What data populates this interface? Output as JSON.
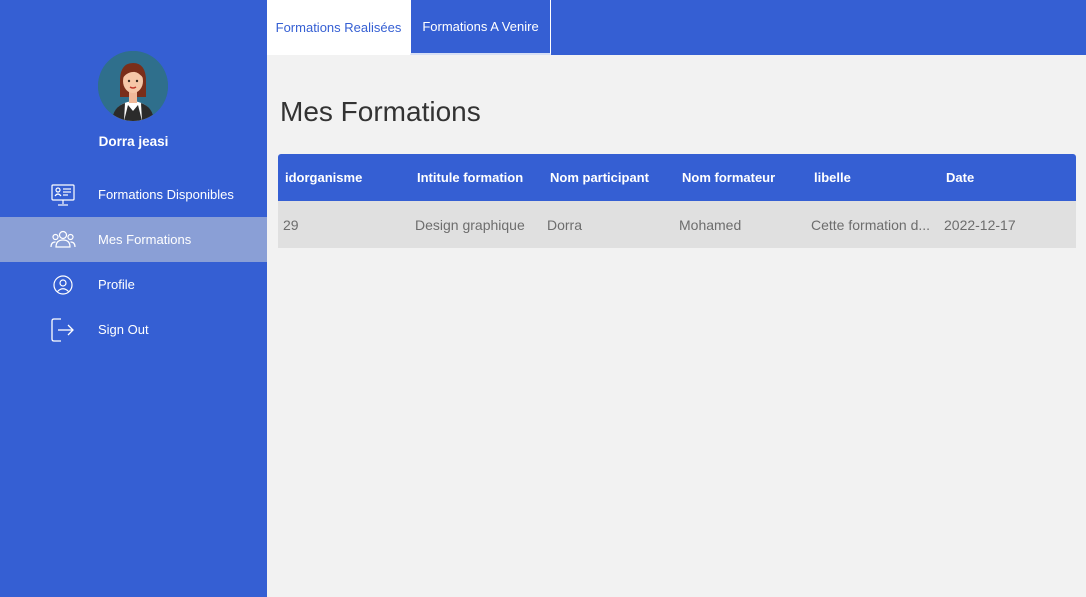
{
  "user": {
    "name": "Dorra jeasi"
  },
  "sidebar": {
    "items": [
      {
        "label": "Formations Disponibles",
        "icon": "presentation-board-icon",
        "active": false
      },
      {
        "label": "Mes Formations",
        "icon": "users-group-icon",
        "active": true
      },
      {
        "label": "Profile",
        "icon": "user-circle-icon",
        "active": false
      },
      {
        "label": "Sign Out",
        "icon": "sign-out-icon",
        "active": false
      }
    ]
  },
  "tabs": [
    {
      "label": "Formations Realisées",
      "selected": true
    },
    {
      "label": "Formations A Venire",
      "selected": false
    }
  ],
  "main": {
    "title": "Mes Formations"
  },
  "table": {
    "columns": [
      "idorganisme",
      "Intitule formation",
      "Nom participant",
      "Nom formateur",
      "libelle",
      "Date"
    ],
    "rows": [
      [
        "29",
        "Design graphique",
        "Dorra",
        "Mohamed",
        "Cette formation d...",
        "2022-12-17"
      ]
    ]
  },
  "colors": {
    "primary": "#355fd3",
    "active_nav": "#8a9fd6",
    "background": "#f2f2f2",
    "row_bg": "#e0e0e0"
  }
}
